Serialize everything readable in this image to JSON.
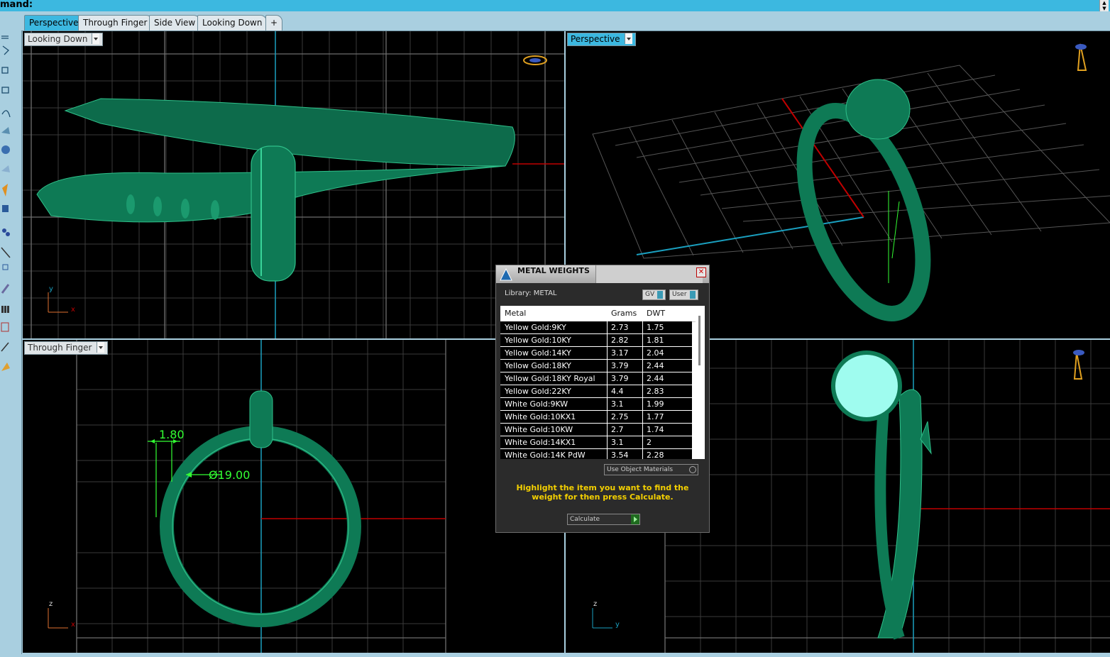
{
  "command_bar": {
    "label": "mand:"
  },
  "tabs": [
    {
      "label": "Perspective",
      "active": true
    },
    {
      "label": "Through Finger",
      "active": false
    },
    {
      "label": "Side View",
      "active": false
    },
    {
      "label": "Looking Down",
      "active": false
    }
  ],
  "viewports": {
    "top_left": {
      "label": "Looking Down",
      "axis_x": "x",
      "axis_y": "y"
    },
    "top_right": {
      "label": "Perspective"
    },
    "bottom_left": {
      "label": "Through Finger",
      "axis_x": "x",
      "axis_y": "z",
      "dim_width": "1.80",
      "dim_diameter": "Ø19.00"
    },
    "bottom_right": {
      "axis_x": "y",
      "axis_y": "z"
    }
  },
  "dialog": {
    "title": "METAL WEIGHTS",
    "library_label": "Library: METAL",
    "gv_button": "GV",
    "user_button": "User",
    "columns": [
      "Metal",
      "Grams",
      "DWT"
    ],
    "rows": [
      {
        "metal": "Yellow Gold:9KY",
        "grams": "2.73",
        "dwt": "1.75"
      },
      {
        "metal": "Yellow Gold:10KY",
        "grams": "2.82",
        "dwt": "1.81"
      },
      {
        "metal": "Yellow Gold:14KY",
        "grams": "3.17",
        "dwt": "2.04"
      },
      {
        "metal": "Yellow Gold:18KY",
        "grams": "3.79",
        "dwt": "2.44"
      },
      {
        "metal": "Yellow Gold:18KY Royal",
        "grams": "3.79",
        "dwt": "2.44"
      },
      {
        "metal": "Yellow Gold:22KY",
        "grams": "4.4",
        "dwt": "2.83"
      },
      {
        "metal": "White Gold:9KW",
        "grams": "3.1",
        "dwt": "1.99"
      },
      {
        "metal": "White Gold:10KX1",
        "grams": "2.75",
        "dwt": "1.77"
      },
      {
        "metal": "White Gold:10KW",
        "grams": "2.7",
        "dwt": "1.74"
      },
      {
        "metal": "White Gold:14KX1",
        "grams": "3.1",
        "dwt": "2"
      },
      {
        "metal": "White Gold:14K PdW",
        "grams": "3.54",
        "dwt": "2.28"
      }
    ],
    "use_object_materials": "Use Object Materials",
    "hint": "Highlight the item you want to find the weight for then press Calculate.",
    "calculate": "Calculate"
  },
  "colors": {
    "ring": "#0e7a55",
    "grid_major": "#6e6e6e",
    "axis_red": "#c00000",
    "axis_cyan": "#1aa0c0",
    "hint_yellow": "#f4d000",
    "dim_green": "#33ff33",
    "active_tab": "#3cb8e0"
  }
}
